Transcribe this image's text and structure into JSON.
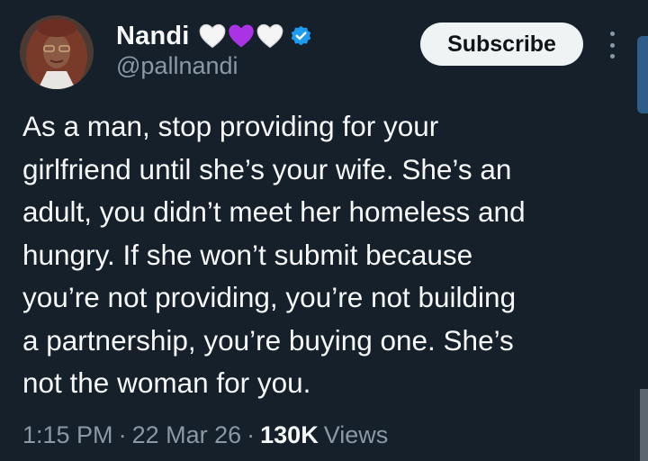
{
  "author": {
    "display_name": "Nandi",
    "handle": "@pallnandi",
    "badges": [
      "white-heart-icon",
      "purple-heart-icon",
      "white-heart-icon",
      "verified-badge-icon"
    ]
  },
  "actions": {
    "subscribe_label": "Subscribe",
    "more_icon": "more-vertical-icon"
  },
  "tweet": {
    "text": "As a man, stop providing for your\ngirlfriend until she’s your wife. She’s an\nadult, you didn’t meet her homeless and\nhungry. If she won’t submit because\nyou’re not providing, you’re not building\na partnership, you’re buying one. She’s\nnot the woman for you."
  },
  "meta": {
    "time": "1:15 PM",
    "separator": "·",
    "date": "22 Mar 26",
    "views_count": "130K",
    "views_label": "Views"
  },
  "colors": {
    "background": "#15202b",
    "text": "#f7f9f9",
    "secondary_text": "#8b98a5",
    "verified": "#1d9bf0",
    "purple_heart": "#aa33e6",
    "button_bg": "#eff3f4"
  }
}
